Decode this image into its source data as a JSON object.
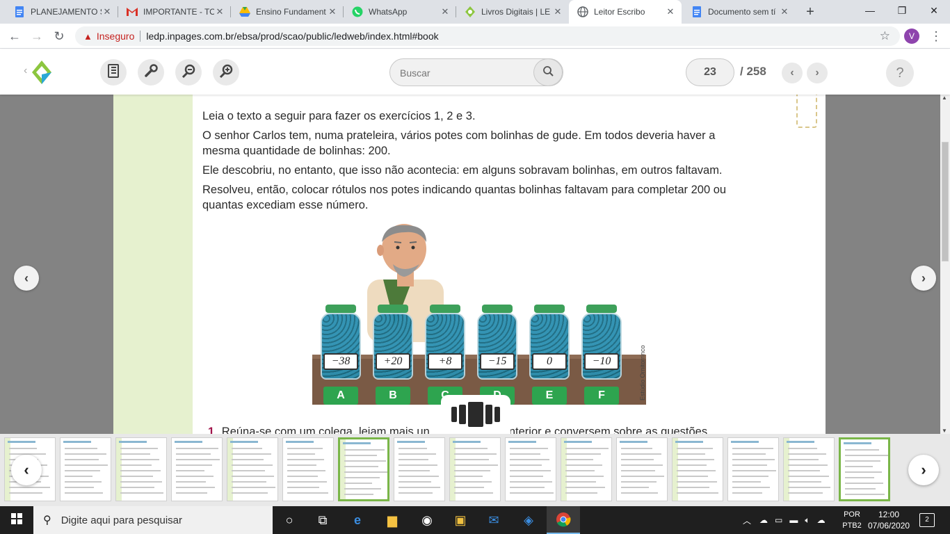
{
  "tabs": [
    {
      "title": "PLANEJAMENTO S",
      "icon": "docs-icon"
    },
    {
      "title": "IMPORTANTE - TO",
      "icon": "gmail-icon"
    },
    {
      "title": "Ensino Fundament",
      "icon": "drive-icon"
    },
    {
      "title": "WhatsApp",
      "icon": "whatsapp-icon"
    },
    {
      "title": "Livros Digitais | LE",
      "icon": "led-icon"
    },
    {
      "title": "Leitor Escribo",
      "icon": "globe-icon",
      "active": true
    },
    {
      "title": "Documento sem tí",
      "icon": "docs-icon"
    }
  ],
  "address_bar": {
    "security_label": "Inseguro",
    "url": "ledp.inpages.com.br/ebsa/prod/scao/public/ledweb/index.html#book",
    "profile_initial": "V"
  },
  "reader": {
    "search_placeholder": "Buscar",
    "current_page": "23",
    "total_pages": "/ 258",
    "help_label": "?"
  },
  "page_content": {
    "p1": "Leia o texto a seguir para fazer os exercícios 1, 2 e 3.",
    "p2": "O senhor Carlos tem, numa prateleira, vários potes com bolinhas de gude. Em todos deveria haver a mesma quantidade de bolinhas: 200.",
    "p3": "Ele descobriu, no entanto, que isso não acontecia: em alguns sobravam bolinhas, em outros faltavam.",
    "p4": "Resolveu, então, colocar rótulos nos potes indicando quantas bolinhas faltavam para completar 200 ou quantas excediam esse número.",
    "jars": [
      {
        "label": "−38",
        "letter": "A"
      },
      {
        "label": "+20",
        "letter": "B"
      },
      {
        "label": "+8",
        "letter": "C"
      },
      {
        "label": "−15",
        "letter": "D"
      },
      {
        "label": "0",
        "letter": "E"
      },
      {
        "label": "−10",
        "letter": "F"
      }
    ],
    "credit": "Estúdio Ornitorrinco",
    "exercise_number": "1",
    "exercise_text_left": "Reúna-se com um colega, leiam mais un",
    "exercise_text_right": "o anterior e conversem sobre as questões"
  },
  "thumbnails": {
    "count": 16,
    "selected_indices": [
      6,
      15
    ]
  },
  "taskbar": {
    "search_placeholder": "Digite aqui para pesquisar",
    "lang_1": "POR",
    "lang_2": "PTB2",
    "time": "12:00",
    "date": "07/06/2020",
    "notifications": "2"
  },
  "colors": {
    "accent_green": "#7ab648",
    "label_green": "#2ea44f",
    "jar_lid": "#3da05a",
    "marbles": "#2a8fb0",
    "shelf": "#7a5a45"
  }
}
